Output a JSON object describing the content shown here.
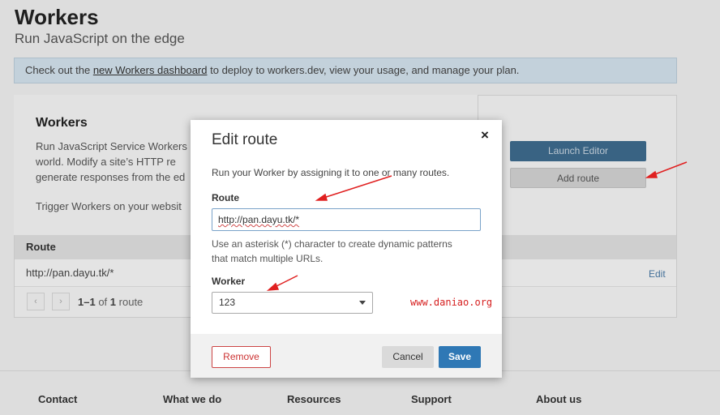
{
  "header": {
    "title": "Workers",
    "subtitle": "Run JavaScript on the edge"
  },
  "banner": {
    "text_before": "Check out the ",
    "link": "new Workers dashboard",
    "text_after": " to deploy to workers.dev, view your usage, and manage your plan."
  },
  "card": {
    "title": "Workers",
    "desc_line1": "Run JavaScript Service Workers",
    "desc_line2": "world. Modify a site’s HTTP re",
    "desc_line3": "generate responses from the ed",
    "trigger": "Trigger Workers on your websit",
    "launch_editor": "Launch Editor",
    "add_route": "Add route"
  },
  "routes_table": {
    "column": "Route",
    "rows": [
      {
        "route": "http://pan.dayu.tk/*",
        "action": "Edit"
      }
    ],
    "pager": {
      "range": "1–1",
      "of": "of",
      "total": "1",
      "unit": "route",
      "prev": "‹",
      "next": "›"
    }
  },
  "modal": {
    "title": "Edit route",
    "close": "×",
    "intro": "Run your Worker by assigning it to one or many routes.",
    "route_label": "Route",
    "route_value": "http://pan.dayu.tk/*",
    "hint_line1": "Use an asterisk (*) character to create dynamic patterns",
    "hint_line2": "that match multiple URLs.",
    "worker_label": "Worker",
    "worker_value": "123",
    "remove": "Remove",
    "cancel": "Cancel",
    "save": "Save"
  },
  "watermark": "www.daniao.org",
  "footer": {
    "links": [
      "Contact",
      "What we do",
      "Resources",
      "Support",
      "About us"
    ]
  },
  "colors": {
    "accent": "#2f78b5",
    "danger": "#cc3333",
    "annotation": "#e02020"
  }
}
